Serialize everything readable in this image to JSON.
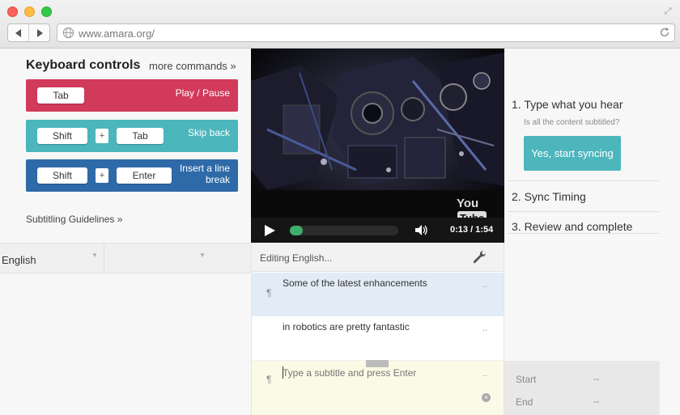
{
  "browser": {
    "url": "www.amara.org/"
  },
  "keyboard": {
    "title": "Keyboard controls",
    "more_link": "more commands »",
    "shortcuts": [
      {
        "keys": [
          "Tab"
        ],
        "action": "Play / Pause",
        "color": "#d13a5b"
      },
      {
        "keys": [
          "Shift",
          "Tab"
        ],
        "plus": "+",
        "action": "Skip back",
        "color": "#4bb6bc"
      },
      {
        "keys": [
          "Shift",
          "Enter"
        ],
        "plus": "+",
        "action": "Insert a line break",
        "color": "#2f6aa8"
      }
    ],
    "guidelines_link": "Subtitling Guidelines »"
  },
  "language_bar": {
    "selected_language": "English"
  },
  "video": {
    "logo_you": "You",
    "logo_tube": "Tube",
    "time": "0:13 / 1:54",
    "progress": 0.12
  },
  "steps": {
    "step1_title": "1. Type what you hear",
    "step1_question": "Is all the content subtitled?",
    "sync_button": "Yes, start syncing",
    "step2_title": "2. Sync Timing",
    "step3_title": "3. Review and complete"
  },
  "editor": {
    "title": "Editing English...",
    "pilcrow": "¶",
    "rows": [
      {
        "text": "Some of the latest enhancements",
        "dots": ".."
      },
      {
        "text": "in robotics are pretty fantastic",
        "dots": ".."
      }
    ],
    "input_placeholder": "Type a subtitle and press Enter",
    "input_dots": ".."
  },
  "timing": {
    "start_label": "Start",
    "start_value": "--",
    "end_label": "End",
    "end_value": "--"
  },
  "colors": {
    "play_row": "#d13a5b",
    "skip_row": "#4bb6bc",
    "insert_row": "#2f6aa8",
    "sync_button": "#4cb6bc",
    "progress_fill": "#3fae6a"
  }
}
